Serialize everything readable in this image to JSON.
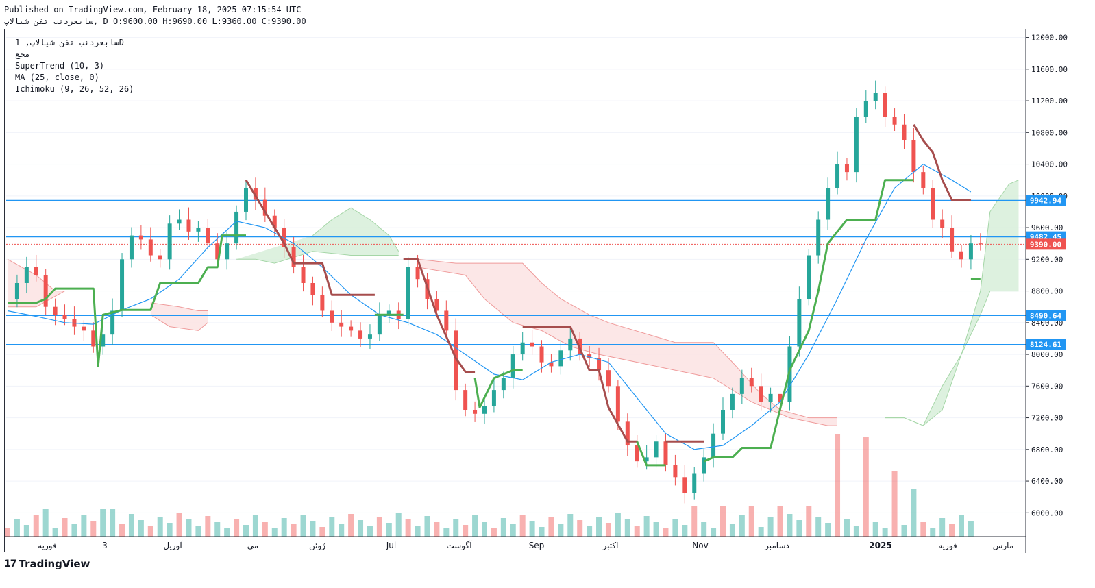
{
  "header": {
    "published": "Published on TradingView.com, February 18, 2025 07:15:54 UTC",
    "symbol": "سابعردنب تفن شیالاپ",
    "ohlc": ", D O:9600.00 H:9690.00 L:9360.00 C:9390.00"
  },
  "legend": {
    "title": "سابعردنب تفن شیالاپ, 1D",
    "exchange": "مجع",
    "supertrend": "SuperTrend (10, 3)",
    "ma": "MA (25, close, 0)",
    "ichimoku": "Ichimoku (9, 26, 52, 26)"
  },
  "brand": {
    "logo": "17",
    "name": "TradingView"
  },
  "colors": {
    "up": "#26a69a",
    "down": "#ef5350",
    "supertrend_up": "#4caf50",
    "supertrend_down": "#a64d4d",
    "ma": "#2196f3",
    "hline": "#2196f3",
    "cloud_up": "#d7eed9",
    "cloud_down": "#fbe3e3"
  },
  "chart_data": {
    "type": "candlestick",
    "y_axis": {
      "min": 5700,
      "max": 12100,
      "ticks": [
        "12000.00",
        "11600.00",
        "11200.00",
        "10800.00",
        "10400.00",
        "10000.00",
        "9600.00",
        "9200.00",
        "8800.00",
        "8400.00",
        "8000.00",
        "7600.00",
        "7200.00",
        "6800.00",
        "6400.00",
        "6000.00"
      ]
    },
    "x_axis": {
      "labels": [
        "فوریه",
        "3",
        "آوریل",
        "می",
        "ژوئن",
        "Jul",
        "آگوست",
        "Sep",
        "اکتبر",
        "Nov",
        "دسامبر",
        "2025",
        "فوریه",
        "مارس"
      ]
    },
    "horizontal_lines": [
      {
        "value": 9942.94,
        "label": "9942.94"
      },
      {
        "value": 9482.45,
        "label": "9482.45"
      },
      {
        "value": 8490.64,
        "label": "8490.64"
      },
      {
        "value": 8124.61,
        "label": "8124.61"
      }
    ],
    "last_price": {
      "value": 9390,
      "label": "9390.00"
    },
    "supertrend": [
      {
        "trend": "up",
        "points": [
          [
            0,
            8650
          ],
          [
            3,
            8650
          ],
          [
            4,
            8700
          ],
          [
            5,
            8830
          ],
          [
            6,
            8830
          ],
          [
            9,
            8830
          ],
          [
            9.5,
            7850
          ],
          [
            10,
            8500
          ],
          [
            12,
            8560
          ],
          [
            15,
            8560
          ],
          [
            16,
            8900
          ],
          [
            20,
            8900
          ],
          [
            21,
            9100
          ],
          [
            22,
            9100
          ],
          [
            22.5,
            9500
          ],
          [
            25,
            9500
          ]
        ]
      },
      {
        "trend": "down",
        "points": [
          [
            25,
            10200
          ],
          [
            27,
            9800
          ],
          [
            29,
            9400
          ],
          [
            30,
            9150
          ],
          [
            33,
            9150
          ],
          [
            34,
            8750
          ],
          [
            38,
            8750
          ],
          [
            38.5,
            8750
          ]
        ]
      },
      {
        "trend": "up",
        "points": [
          [
            38.5,
            8500
          ],
          [
            41,
            8500
          ],
          [
            41.5,
            8500
          ]
        ]
      },
      {
        "trend": "down",
        "points": [
          [
            41.5,
            9200
          ],
          [
            43,
            9200
          ],
          [
            45,
            8500
          ],
          [
            47,
            7950
          ],
          [
            48,
            7780
          ],
          [
            49,
            7780
          ]
        ]
      },
      {
        "trend": "up",
        "points": [
          [
            49,
            7700
          ],
          [
            49.5,
            7330
          ],
          [
            51,
            7700
          ],
          [
            53,
            7800
          ],
          [
            54,
            7800
          ]
        ]
      },
      {
        "trend": "down",
        "points": [
          [
            54,
            8350
          ],
          [
            59,
            8350
          ],
          [
            61,
            7800
          ],
          [
            62,
            7800
          ],
          [
            63,
            7330
          ],
          [
            65,
            6900
          ],
          [
            66,
            6900
          ]
        ]
      },
      {
        "trend": "up",
        "points": [
          [
            66,
            6900
          ],
          [
            67,
            6600
          ],
          [
            69,
            6600
          ]
        ]
      },
      {
        "trend": "down",
        "points": [
          [
            69,
            6900
          ],
          [
            73,
            6900
          ]
        ]
      },
      {
        "trend": "up",
        "points": [
          [
            73,
            6650
          ],
          [
            74,
            6700
          ],
          [
            76,
            6700
          ],
          [
            77,
            6820
          ],
          [
            80,
            6820
          ],
          [
            82,
            7800
          ],
          [
            84,
            8300
          ],
          [
            85,
            8800
          ],
          [
            86,
            9400
          ],
          [
            88,
            9700
          ],
          [
            91,
            9700
          ],
          [
            92,
            10200
          ],
          [
            95,
            10200
          ]
        ]
      },
      {
        "trend": "down",
        "points": [
          [
            95,
            10900
          ],
          [
            96,
            10700
          ],
          [
            97,
            10550
          ],
          [
            98,
            10200
          ],
          [
            99,
            9950
          ],
          [
            101,
            9950
          ]
        ]
      },
      {
        "trend": "up",
        "points": [
          [
            101,
            8950
          ],
          [
            102,
            8950
          ]
        ]
      }
    ],
    "ma": [
      [
        0,
        8550
      ],
      [
        3,
        8480
      ],
      [
        6,
        8400
      ],
      [
        9,
        8380
      ],
      [
        12,
        8560
      ],
      [
        15,
        8700
      ],
      [
        18,
        8950
      ],
      [
        21,
        9350
      ],
      [
        24,
        9680
      ],
      [
        27,
        9600
      ],
      [
        30,
        9400
      ],
      [
        33,
        9100
      ],
      [
        36,
        8750
      ],
      [
        39,
        8500
      ],
      [
        42,
        8400
      ],
      [
        45,
        8250
      ],
      [
        48,
        8000
      ],
      [
        51,
        7750
      ],
      [
        54,
        7680
      ],
      [
        57,
        7900
      ],
      [
        60,
        8000
      ],
      [
        63,
        7900
      ],
      [
        66,
        7450
      ],
      [
        69,
        7000
      ],
      [
        72,
        6800
      ],
      [
        75,
        6850
      ],
      [
        78,
        7100
      ],
      [
        81,
        7400
      ],
      [
        84,
        8000
      ],
      [
        87,
        8700
      ],
      [
        90,
        9450
      ],
      [
        93,
        10100
      ],
      [
        96,
        10400
      ],
      [
        99,
        10200
      ],
      [
        101,
        10050
      ]
    ]
  }
}
